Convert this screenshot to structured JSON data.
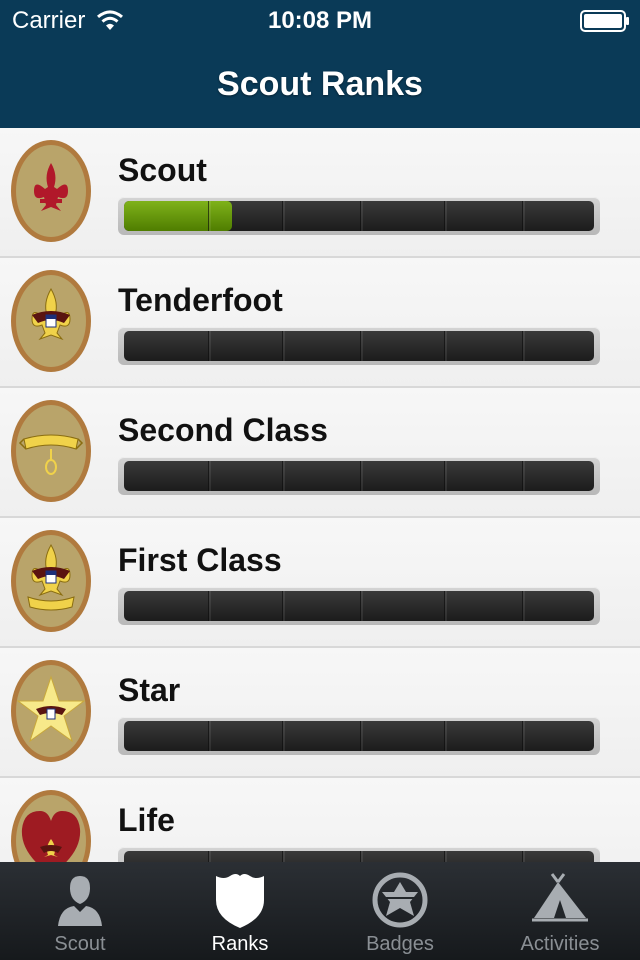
{
  "status_bar": {
    "carrier": "Carrier",
    "time": "10:08 PM"
  },
  "nav": {
    "title": "Scout Ranks"
  },
  "colors": {
    "nav_background": "#0a3a57",
    "progress_fill": "#5f9200",
    "tab_active": "#ffffff",
    "tab_inactive": "#8a8f94"
  },
  "ranks": [
    {
      "name": "Scout",
      "progress": 0.23,
      "badge_icon": "fleur-de-lis-icon"
    },
    {
      "name": "Tenderfoot",
      "progress": 0,
      "badge_icon": "eagle-fleur-icon"
    },
    {
      "name": "Second Class",
      "progress": 0,
      "badge_icon": "scroll-icon"
    },
    {
      "name": "First Class",
      "progress": 0,
      "badge_icon": "eagle-scroll-icon"
    },
    {
      "name": "Star",
      "progress": 0,
      "badge_icon": "star-icon"
    },
    {
      "name": "Life",
      "progress": 0,
      "badge_icon": "heart-icon"
    }
  ],
  "tabs": [
    {
      "label": "Scout",
      "icon": "person-icon",
      "active": false
    },
    {
      "label": "Ranks",
      "icon": "shield-icon",
      "active": true
    },
    {
      "label": "Badges",
      "icon": "emblem-icon",
      "active": false
    },
    {
      "label": "Activities",
      "icon": "tent-icon",
      "active": false
    }
  ]
}
